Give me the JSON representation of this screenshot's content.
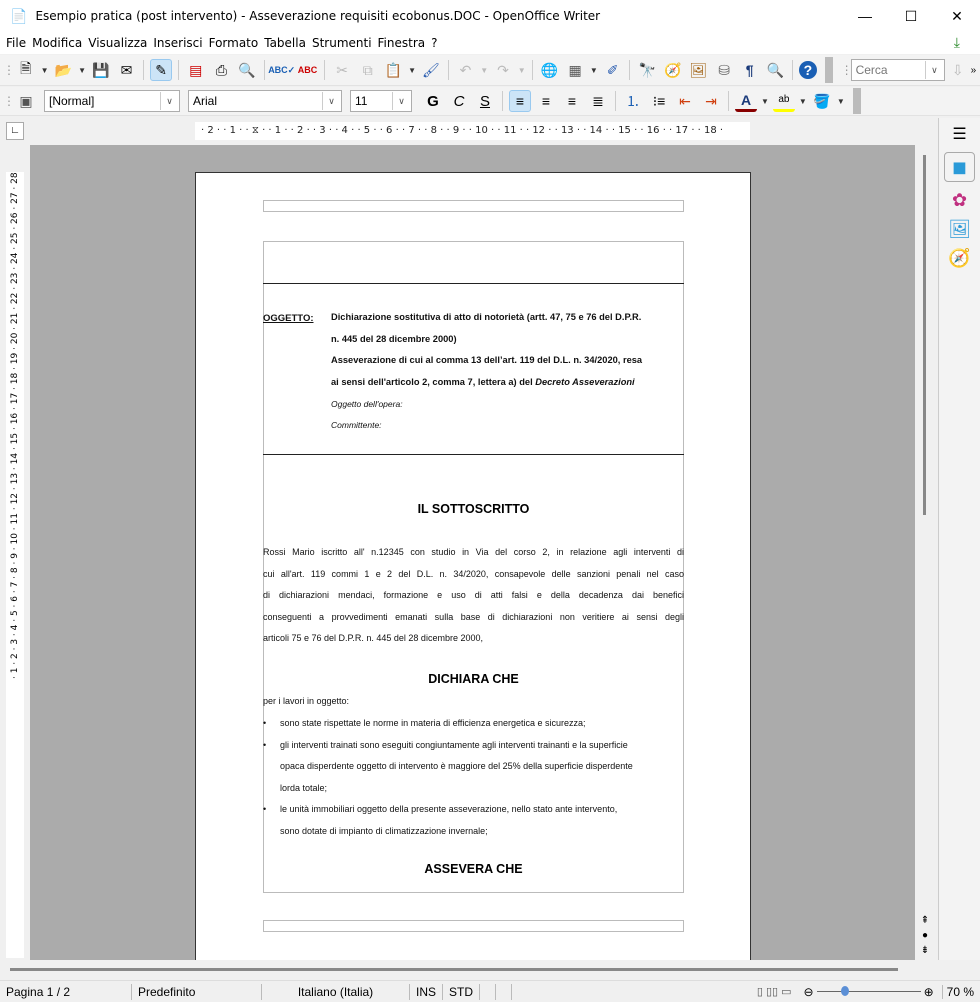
{
  "window": {
    "title": "Esempio pratica (post intervento) - Asseverazione requisiti ecobonus.DOC - OpenOffice Writer"
  },
  "menu": [
    "File",
    "Modifica",
    "Visualizza",
    "Inserisci",
    "Formato",
    "Tabella",
    "Strumenti",
    "Finestra",
    "?"
  ],
  "toolbar": {
    "search_placeholder": "Cerca",
    "style": "[Normal]",
    "font": "Arial",
    "size": "11",
    "bold": "G",
    "italic": "C",
    "underline": "S"
  },
  "ruler": {
    "h": "· 2 · · 1 · · ⧖ · · 1 · · 2 · · 3 · · 4 · · 5 · · 6 · · 7 · · 8 · · 9 · · 10 · · 11 · · 12 · · 13 · · 14 · · 15 · · 16 · · 17 · · 18 ·",
    "v": "· 1 · 2 · 3 · 4 · 5 · 6 · 7 · 8 · 9 · 10 · 11 · 12 · 13 · 14 · 15 · 16 · 17 · 18 · 19 · 20 · 21 · 22 · 23 · 24 · 25 · 26 · 27 · 28"
  },
  "document": {
    "oggetto_label": "OGGETTO:",
    "oggetto_lines": [
      "Dichiarazione sostitutiva di atto di notorietà (artt. 47, 75 e 76 del D.P.R.",
      "n. 445 del 28 dicembre 2000)",
      "Asseverazione di cui al comma 13 dell’art. 119 del D.L. n. 34/2020, resa"
    ],
    "oggetto_line4": "ai sensi dell'articolo 2, comma 7, lettera a) del ",
    "oggetto_line4_italic": "Decreto Asseverazioni",
    "oggetto_opera": "Oggetto dell'opera:",
    "committente": "Committente:",
    "heading1": "IL SOTTOSCRITTO",
    "para_lines": [
      "Rossi Mario iscritto all' n.12345 con studio in Via del corso 2, in relazione agli interventi di",
      "cui all'art. 119 commi 1 e 2 del D.L. n. 34/2020, consapevole delle sanzioni penali nel caso",
      "di dichiarazioni mendaci, formazione e uso di atti falsi e della decadenza dai benefici",
      "conseguenti a provvedimenti emanati sulla base di dichiarazioni non veritiere ai sensi degli"
    ],
    "para_last": "articoli 75 e 76 del D.P.R. n. 445 del 28 dicembre 2000,",
    "heading2": "DICHIARA CHE",
    "intro": "per i lavori in oggetto:",
    "bullets": [
      [
        "sono state rispettate le norme in materia di efficienza energetica e sicurezza;"
      ],
      [
        "gli interventi trainati sono eseguiti congiuntamente agli interventi trainanti e la superficie",
        "opaca disperdente oggetto di intervento è maggiore del 25% della superficie disperdente",
        "lorda totale;"
      ],
      [
        "le unità immobiliari oggetto della presente asseverazione, nello stato ante intervento,",
        "sono dotate di impianto di climatizzazione invernale;"
      ]
    ],
    "heading3": "ASSEVERA CHE"
  },
  "status": {
    "page": "Pagina 1 / 2",
    "style": "Predefinito",
    "language": "Italiano (Italia)",
    "mode": "INS",
    "selection": "STD",
    "zoom": "70 %"
  }
}
